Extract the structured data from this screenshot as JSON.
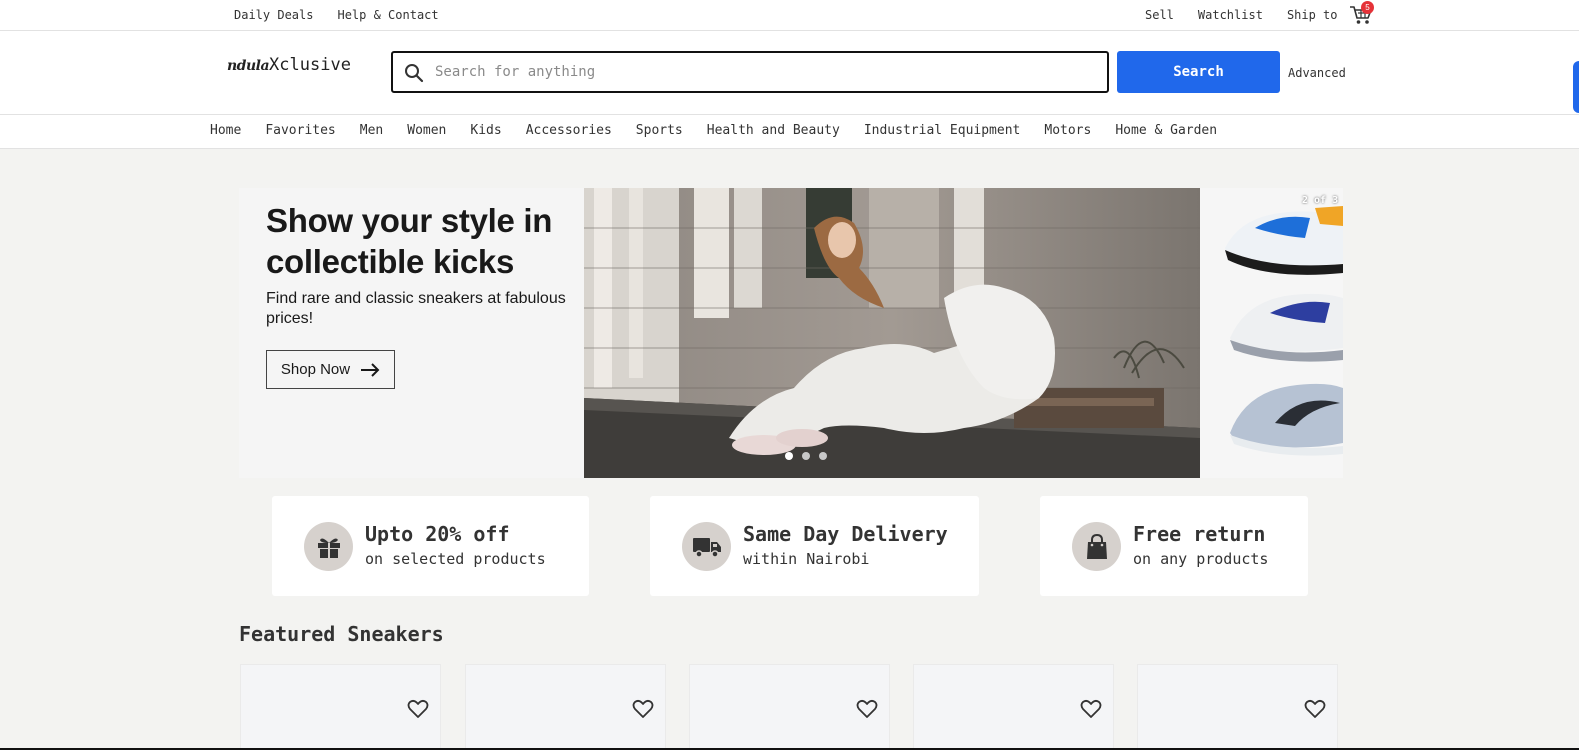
{
  "topbar": {
    "left_links": [
      "Daily Deals",
      "Help & Contact"
    ],
    "right_links": [
      "Sell",
      "Watchlist",
      "Ship to"
    ],
    "cart_count": "5"
  },
  "header": {
    "logo_script": "ndula",
    "logo_rest": "Xclusive",
    "search_placeholder": "Search for anything",
    "search_value": "",
    "search_button": "Search",
    "advanced": "Advanced"
  },
  "nav": {
    "items": [
      "Home",
      "Favorites",
      "Men",
      "Women",
      "Kids",
      "Accessories",
      "Sports",
      "Health and Beauty",
      "Industrial Equipment",
      "Motors",
      "Home & Garden"
    ]
  },
  "hero": {
    "title": "Show your style in collectible kicks",
    "subtitle": "Find rare and classic sneakers at fabulous prices!",
    "button": "Shop Now",
    "slide_counter": "2 of 3",
    "slide_count": 3,
    "active_slide": 1
  },
  "features": [
    {
      "icon": "gift-icon",
      "title": "Upto 20% off",
      "subtitle": "on selected products"
    },
    {
      "icon": "truck-icon",
      "title": "Same Day Delivery",
      "subtitle": "within Nairobi"
    },
    {
      "icon": "shopping-bag-icon",
      "title": "Free return",
      "subtitle": "on any products"
    }
  ],
  "featured": {
    "title": "Featured Sneakers",
    "product_count": 5
  },
  "colors": {
    "accent": "#2068eb",
    "badge": "#e53238",
    "page_bg": "#f3f3f1"
  }
}
